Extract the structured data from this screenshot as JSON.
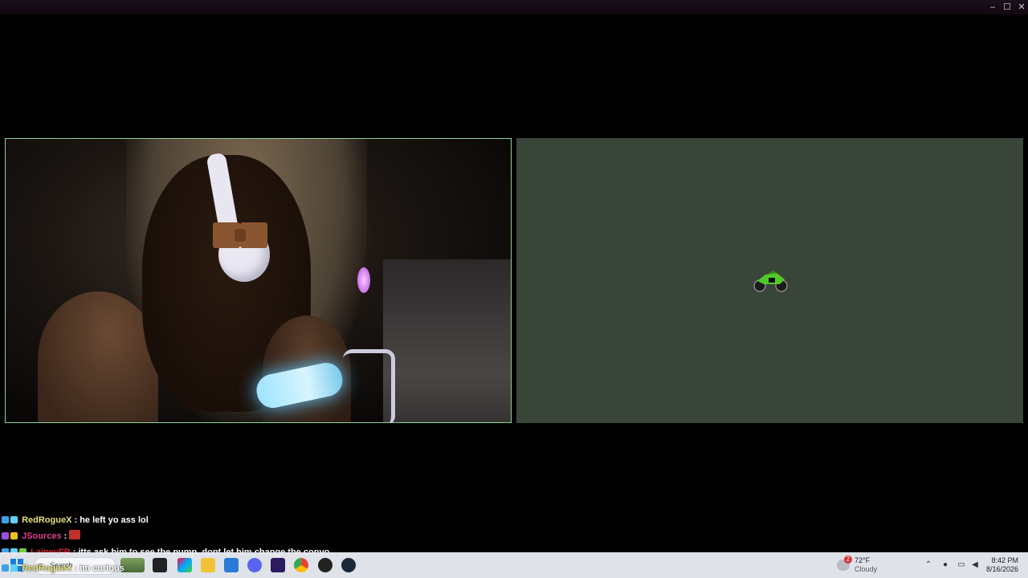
{
  "window": {
    "controls": {
      "minimize": "–",
      "maximize": "☐",
      "close": "✕"
    }
  },
  "chat": [
    {
      "user": "RedRogueX",
      "sep": " : ",
      "message": "he left yo ass lol",
      "user_color": "#e6e07a"
    },
    {
      "user": "JSources",
      "sep": " : ",
      "message": "",
      "user_color": "#e0408a"
    },
    {
      "user": "LaineyFR",
      "sep": " : ",
      "message": "itts ask him to see the pump, dont let him change the convo",
      "user_color": "#e02030"
    },
    {
      "user": "RedRogueX",
      "sep": " : ",
      "message": "im curious",
      "user_color": "#e6e07a"
    }
  ],
  "taskbar": {
    "search_placeholder": "Search",
    "icons": [
      "start-icon",
      "search-icon",
      "widgets-icon",
      "task-view-icon",
      "ms-store-icon",
      "file-explorer-icon",
      "microsoft-store-icon",
      "discord-icon",
      "amazon-music-icon",
      "chrome-icon",
      "obs-icon",
      "steam-icon"
    ],
    "weather": {
      "badge": "2",
      "temp": "72°F",
      "condition": "Cloudy"
    },
    "clock": {
      "time": "8:42 PM",
      "date": "8/16/2026"
    }
  },
  "colors": {
    "cam_border": "#8fd49a",
    "game_bg": "#3a4539",
    "taskbar_bg": "#e6e9f0",
    "moto_green": "#4fc92a"
  }
}
